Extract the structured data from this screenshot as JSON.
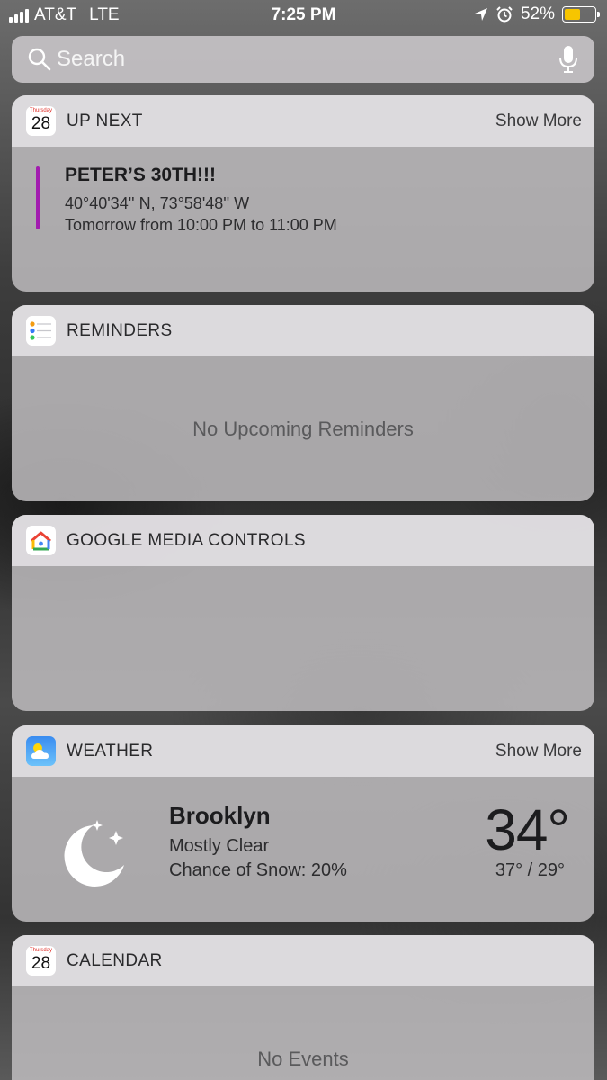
{
  "status_bar": {
    "carrier": "AT&T",
    "network": "LTE",
    "time": "7:25 PM",
    "battery_percent": "52%",
    "battery_level": 0.52,
    "battery_color": "#f7c500"
  },
  "search": {
    "placeholder": "Search",
    "left_icon": "search-icon",
    "right_icon": "mic-icon"
  },
  "widgets": {
    "up_next": {
      "icon": "calendar-icon",
      "icon_day_label": "Thursday",
      "icon_day_num": "28",
      "title": "UP NEXT",
      "show_more": "Show More",
      "event": {
        "title": "PETER’S 30TH!!!",
        "location": "40°40'34'' N, 73°58'48'' W",
        "time": "Tomorrow from 10:00 PM to 11:00 PM",
        "color": "#a21caf"
      }
    },
    "reminders": {
      "icon": "reminders-icon",
      "title": "REMINDERS",
      "empty": "No Upcoming Reminders"
    },
    "google_media": {
      "icon": "google-home-icon",
      "title": "GOOGLE MEDIA CONTROLS"
    },
    "weather": {
      "icon": "weather-app-icon",
      "title": "WEATHER",
      "show_more": "Show More",
      "condition_icon": "moon-stars-icon",
      "city": "Brooklyn",
      "condition": "Mostly Clear",
      "snow": "Chance of Snow: 20%",
      "temperature": "34°",
      "hi_lo": "37° / 29°"
    },
    "calendar": {
      "icon": "calendar-icon",
      "icon_day_label": "Thursday",
      "icon_day_num": "28",
      "title": "CALENDAR",
      "empty": "No Events"
    }
  }
}
